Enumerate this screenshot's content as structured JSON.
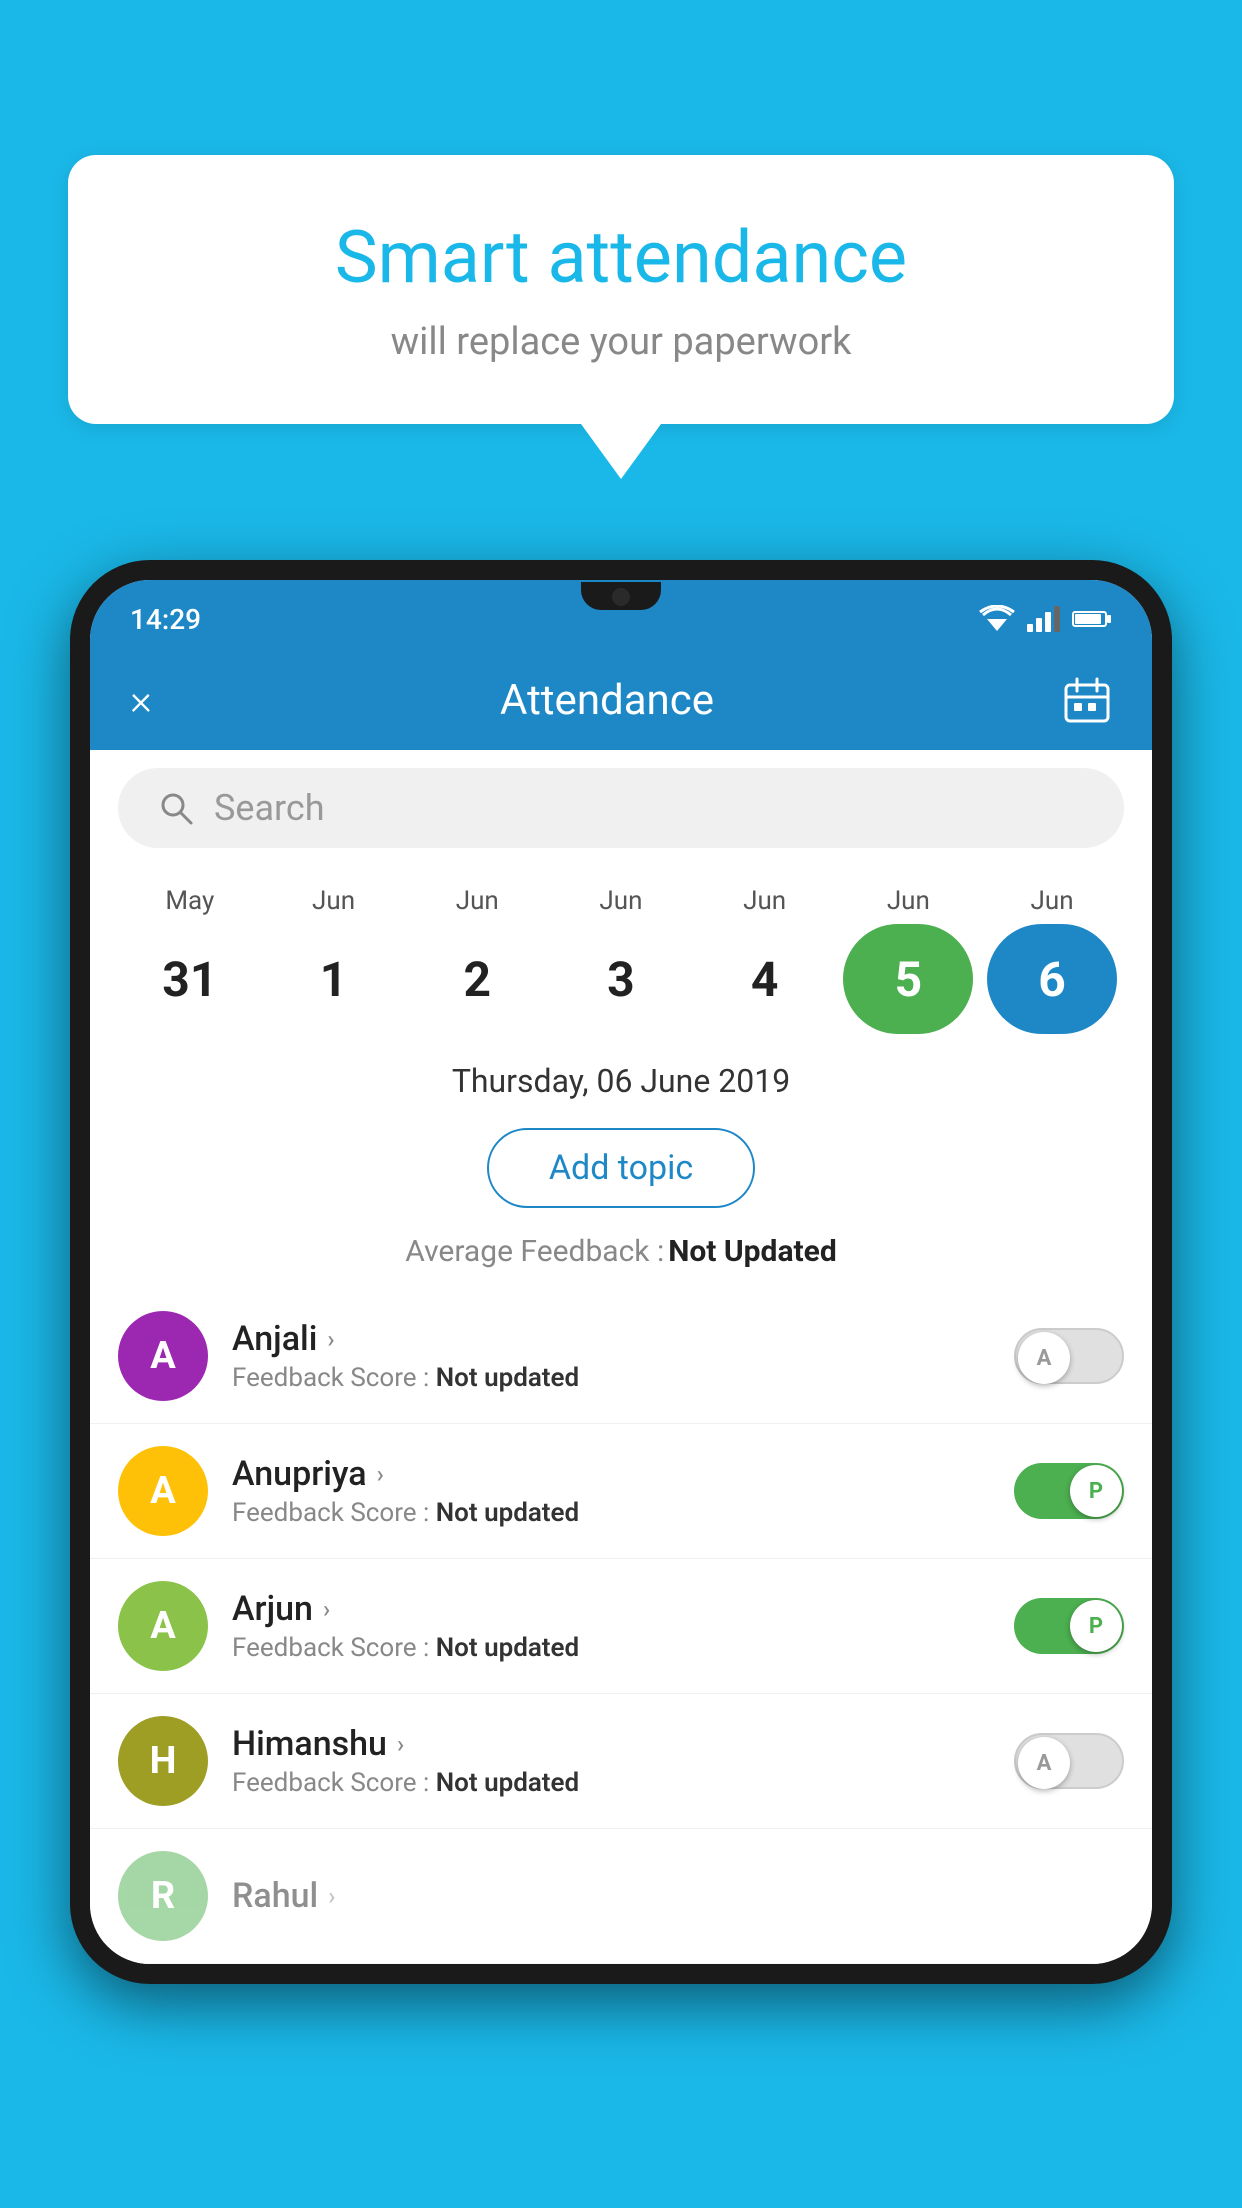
{
  "background_color": "#1ab8e8",
  "speech_bubble": {
    "title": "Smart attendance",
    "subtitle": "will replace your paperwork"
  },
  "phone": {
    "status_bar": {
      "time": "14:29"
    },
    "app_bar": {
      "title": "Attendance",
      "close_label": "×",
      "calendar_icon": "📅"
    },
    "search": {
      "placeholder": "Search"
    },
    "calendar": {
      "months": [
        "May",
        "Jun",
        "Jun",
        "Jun",
        "Jun",
        "Jun",
        "Jun"
      ],
      "dates": [
        "31",
        "1",
        "2",
        "3",
        "4",
        "5",
        "6"
      ],
      "selected_today": 4,
      "selected_current": 5
    },
    "selected_date": "Thursday, 06 June 2019",
    "add_topic_label": "Add topic",
    "avg_feedback_label": "Average Feedback :",
    "avg_feedback_value": "Not Updated",
    "students": [
      {
        "name": "Anjali",
        "initial": "A",
        "avatar_color": "purple",
        "feedback_label": "Feedback Score :",
        "feedback_value": "Not updated",
        "toggle_state": "off",
        "toggle_label": "A"
      },
      {
        "name": "Anupriya",
        "initial": "A",
        "avatar_color": "yellow",
        "feedback_label": "Feedback Score :",
        "feedback_value": "Not updated",
        "toggle_state": "on",
        "toggle_label": "P"
      },
      {
        "name": "Arjun",
        "initial": "A",
        "avatar_color": "green",
        "feedback_label": "Feedback Score :",
        "feedback_value": "Not updated",
        "toggle_state": "on",
        "toggle_label": "P"
      },
      {
        "name": "Himanshu",
        "initial": "H",
        "avatar_color": "olive",
        "feedback_label": "Feedback Score :",
        "feedback_value": "Not updated",
        "toggle_state": "off",
        "toggle_label": "A"
      }
    ]
  }
}
